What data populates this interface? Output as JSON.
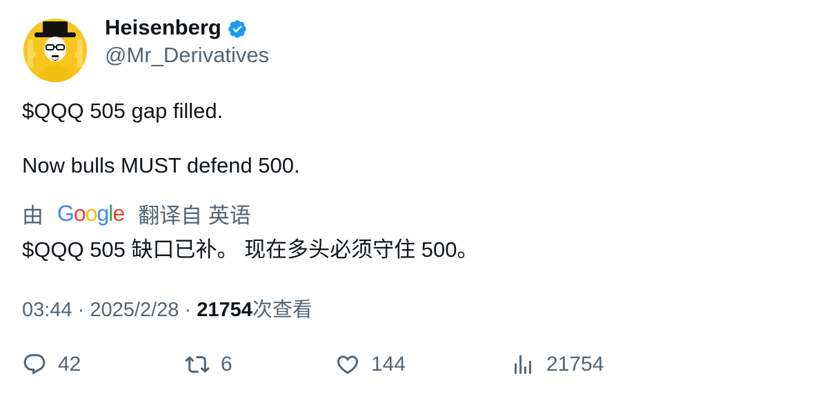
{
  "author": {
    "display_name": "Heisenberg",
    "handle": "@Mr_Derivatives",
    "verified": true,
    "verified_color": "#1d9bf0",
    "avatar_bg": "#f5c518"
  },
  "tweet": {
    "line1": "$QQQ 505 gap filled.",
    "line2": "Now bulls MUST defend 500."
  },
  "translation": {
    "prefix": "由",
    "provider": "Google",
    "suffix": "翻译自 英语",
    "text": "$QQQ 505 缺口已补。 现在多头必须守住 500。"
  },
  "meta": {
    "time": "03:44",
    "separator": "·",
    "date": "2025/2/28",
    "views_count": "21754",
    "views_label": "次查看"
  },
  "actions": {
    "replies": "42",
    "retweets": "6",
    "likes": "144",
    "views": "21754"
  }
}
